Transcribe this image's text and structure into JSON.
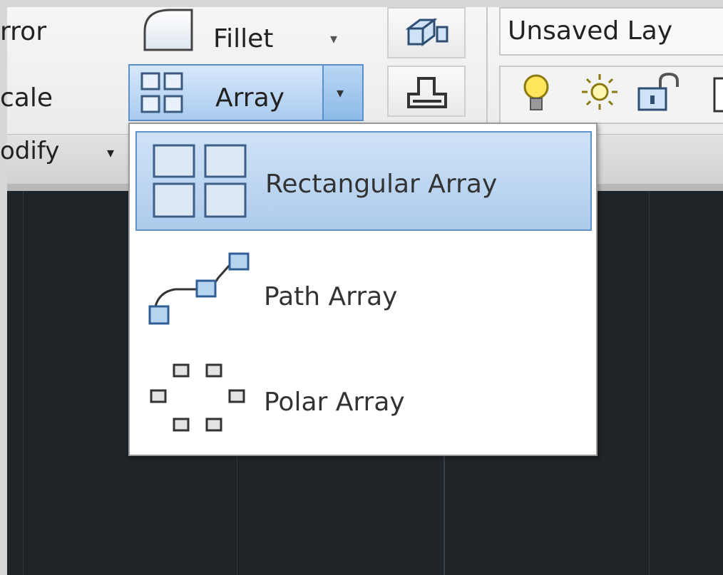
{
  "ribbon": {
    "modify_panel": {
      "mirror_label": "rror",
      "scale_label": "cale",
      "panel_title": "odify",
      "panel_arrow": "▾",
      "fillet": {
        "label": "Fillet",
        "arrow": "▾"
      },
      "array": {
        "label": "Array",
        "arrow": "▾"
      }
    },
    "layers_panel": {
      "layer_state": "Unsaved Lay"
    }
  },
  "array_menu": {
    "items": [
      {
        "label": "Rectangular Array",
        "icon": "rectangular-array-icon",
        "selected": true
      },
      {
        "label": "Path Array",
        "icon": "path-array-icon",
        "selected": false
      },
      {
        "label": "Polar Array",
        "icon": "polar-array-icon",
        "selected": false
      }
    ]
  },
  "colors": {
    "highlight": "#aecbec",
    "highlight_border": "#5e93cc",
    "canvas": "#1f2429"
  }
}
